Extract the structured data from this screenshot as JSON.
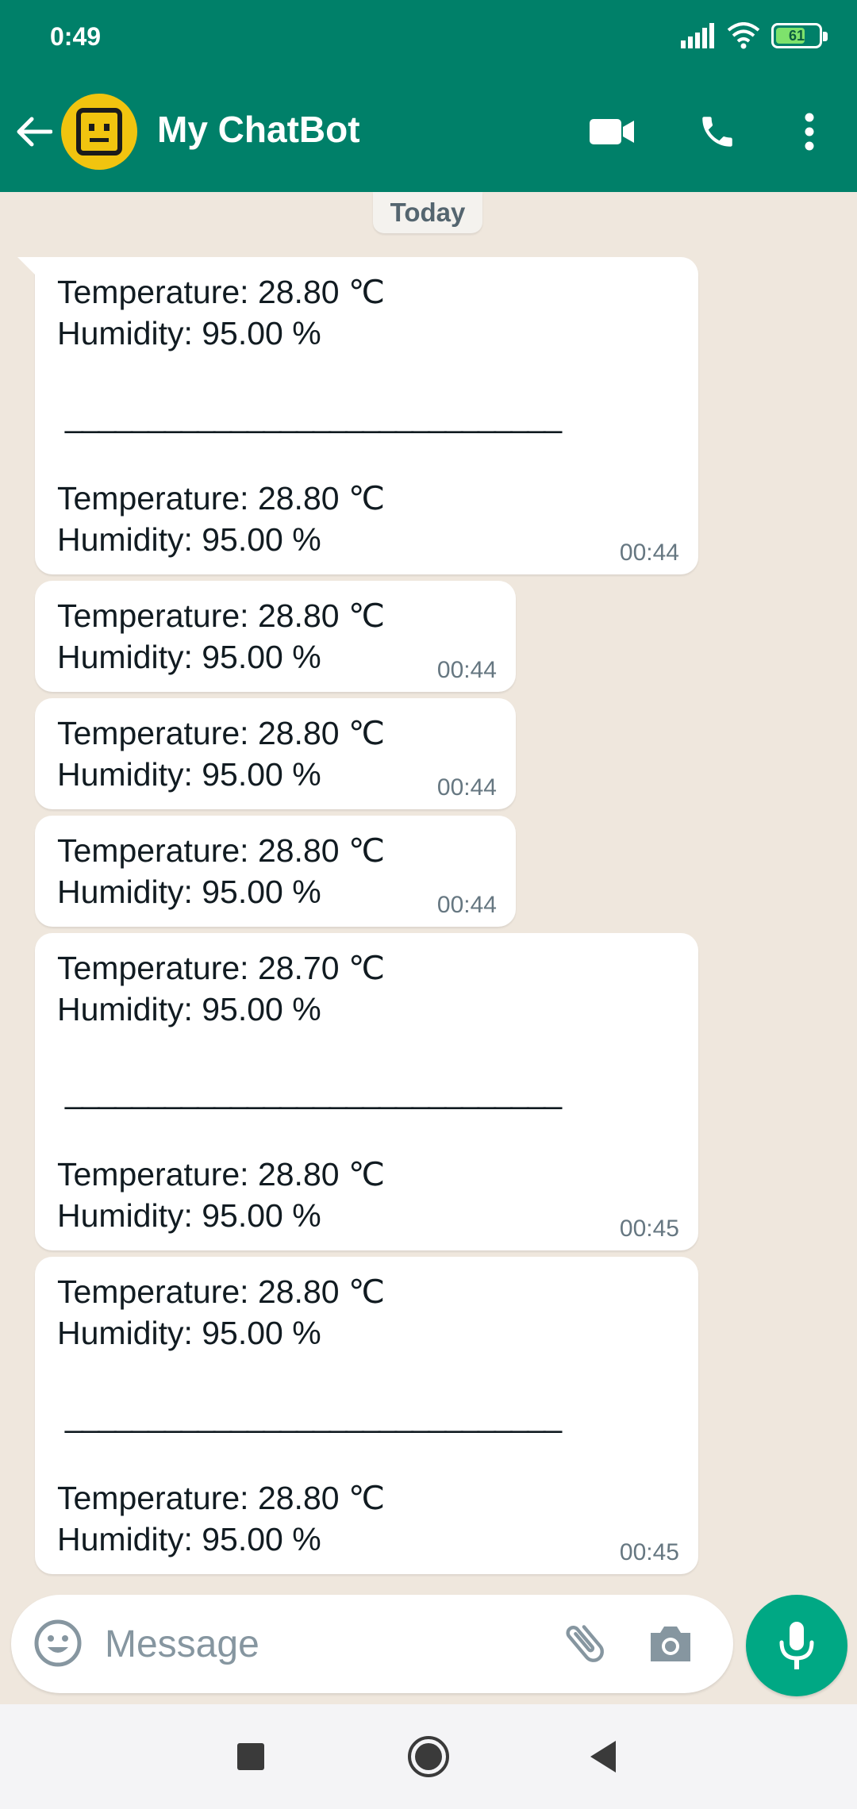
{
  "status_bar": {
    "time": "0:49",
    "battery": "61"
  },
  "header": {
    "contact_name": "My ChatBot"
  },
  "chat": {
    "date_chip": "Today",
    "messages": [
      {
        "lines1": [
          "Temperature: 28.80 ℃",
          "Humidity: 95.00 %"
        ],
        "separator": "______________________________",
        "lines2": [
          "Temperature: 28.80 ℃",
          "Humidity: 95.00 %"
        ],
        "time": "00:44"
      },
      {
        "lines1": [
          "Temperature: 28.80 ℃",
          "Humidity: 95.00 %"
        ],
        "time": "00:44"
      },
      {
        "lines1": [
          "Temperature: 28.80 ℃",
          "Humidity: 95.00 %"
        ],
        "time": "00:44"
      },
      {
        "lines1": [
          "Temperature: 28.80 ℃",
          "Humidity: 95.00 %"
        ],
        "time": "00:44"
      },
      {
        "lines1": [
          "Temperature: 28.70 ℃",
          "Humidity: 95.00 %"
        ],
        "separator": "______________________________",
        "lines2": [
          "Temperature: 28.80 ℃",
          "Humidity: 95.00 %"
        ],
        "time": "00:45"
      },
      {
        "lines1": [
          "Temperature: 28.80 ℃",
          "Humidity: 95.00 %"
        ],
        "separator": "______________________________",
        "lines2": [
          "Temperature: 28.80 ℃",
          "Humidity: 95.00 %"
        ],
        "time": "00:45"
      }
    ]
  },
  "composer": {
    "placeholder": "Message",
    "value": ""
  },
  "colors": {
    "header": "#008069",
    "accent": "#00a884",
    "chat_bg": "#efe7dd",
    "avatar": "#f1c40f"
  },
  "icons": [
    "back-arrow-icon",
    "robot-avatar",
    "video-call-icon",
    "phone-icon",
    "more-vert-icon",
    "emoji-icon",
    "attach-icon",
    "camera-icon",
    "mic-icon",
    "recents-icon",
    "home-icon",
    "back-nav-icon"
  ]
}
